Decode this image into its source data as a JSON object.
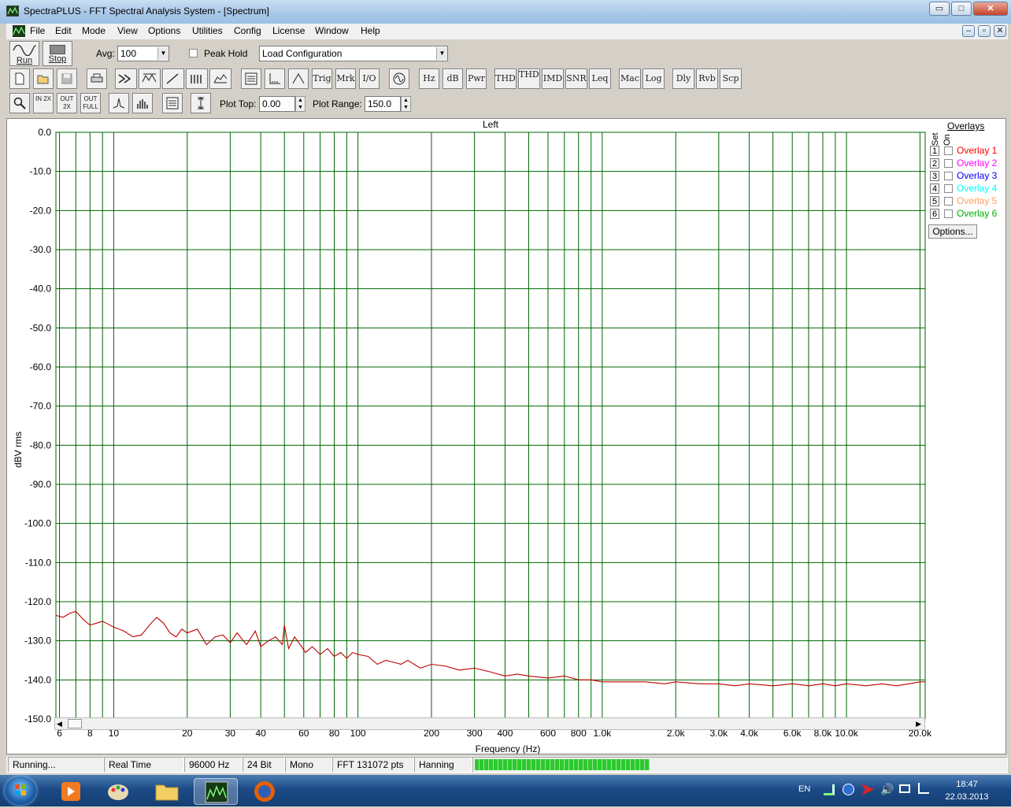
{
  "window": {
    "title": "SpectraPLUS - FFT Spectral Analysis System - [Spectrum]",
    "controls": [
      "▭",
      "□",
      "✕"
    ]
  },
  "mdi_controls": [
    "–",
    "▫",
    "✕"
  ],
  "menu": [
    "File",
    "Edit",
    "Mode",
    "View",
    "Options",
    "Utilities",
    "Config",
    "License",
    "Window",
    "Help"
  ],
  "toolbar1": {
    "run_label": "Run",
    "stop_label": "Stop",
    "avg_label": "Avg:",
    "avg_value": "100",
    "peak_hold_label": "Peak Hold",
    "config_value": "Load Configuration"
  },
  "toolbar2": {
    "buttons": [
      "Trig",
      "Mrk",
      "I/O",
      "Hz",
      "dB",
      "Pwr",
      "THD",
      "THD+N",
      "IMD",
      "SNR",
      "Leq",
      "Mac",
      "Log",
      "Dly",
      "Rvb",
      "Scp"
    ]
  },
  "toolbar3": {
    "zoom_in": "IN 2X",
    "zoom_out": "OUT 2X",
    "zoom_full": "OUT FULL",
    "plot_top_label": "Plot Top:",
    "plot_top_value": "0.00",
    "plot_range_label": "Plot Range:",
    "plot_range_value": "150.0"
  },
  "overlays": {
    "title": "Overlays",
    "set_label": "Set",
    "on_label": "On",
    "items": [
      {
        "num": "1",
        "name": "Overlay 1",
        "color": "#ff0000"
      },
      {
        "num": "2",
        "name": "Overlay 2",
        "color": "#ff00ff"
      },
      {
        "num": "3",
        "name": "Overlay 3",
        "color": "#0000ff"
      },
      {
        "num": "4",
        "name": "Overlay 4",
        "color": "#00ffff"
      },
      {
        "num": "5",
        "name": "Overlay 5",
        "color": "#ffa060"
      },
      {
        "num": "6",
        "name": "Overlay 6",
        "color": "#00b000"
      }
    ],
    "options_label": "Options..."
  },
  "chart_data": {
    "type": "line",
    "title": "Left",
    "xlabel": "Frequency (Hz)",
    "ylabel": "dBV rms",
    "x_scale": "log",
    "xlim": [
      5.8,
      21000
    ],
    "ylim": [
      -150,
      0
    ],
    "grid": true,
    "grid_color": "#006400",
    "trace_color": "#c00000",
    "y_ticks": [
      "0.0",
      "-10.0",
      "-20.0",
      "-30.0",
      "-40.0",
      "-50.0",
      "-60.0",
      "-70.0",
      "-80.0",
      "-90.0",
      "-100.0",
      "-110.0",
      "-120.0",
      "-130.0",
      "-140.0",
      "-150.0"
    ],
    "x_tick_labels": [
      {
        "v": 6,
        "t": "6"
      },
      {
        "v": 8,
        "t": "8"
      },
      {
        "v": 10,
        "t": "10"
      },
      {
        "v": 20,
        "t": "20"
      },
      {
        "v": 30,
        "t": "30"
      },
      {
        "v": 40,
        "t": "40"
      },
      {
        "v": 60,
        "t": "60"
      },
      {
        "v": 80,
        "t": "80"
      },
      {
        "v": 100,
        "t": "100"
      },
      {
        "v": 200,
        "t": "200"
      },
      {
        "v": 300,
        "t": "300"
      },
      {
        "v": 400,
        "t": "400"
      },
      {
        "v": 600,
        "t": "600"
      },
      {
        "v": 800,
        "t": "800"
      },
      {
        "v": 1000,
        "t": "1.0k"
      },
      {
        "v": 2000,
        "t": "2.0k"
      },
      {
        "v": 3000,
        "t": "3.0k"
      },
      {
        "v": 4000,
        "t": "4.0k"
      },
      {
        "v": 6000,
        "t": "6.0k"
      },
      {
        "v": 8000,
        "t": "8.0k"
      },
      {
        "v": 10000,
        "t": "10.0k"
      },
      {
        "v": 20000,
        "t": "20.0k"
      }
    ],
    "series": [
      {
        "x": [
          5.8,
          6.2,
          6.6,
          7,
          7.5,
          8,
          8.5,
          9,
          10,
          11,
          12,
          13,
          14,
          15,
          16,
          17,
          18,
          19,
          20,
          22,
          24,
          26,
          28,
          30,
          32,
          35,
          38,
          40,
          43,
          46,
          49,
          50,
          52,
          55,
          58,
          61,
          65,
          70,
          75,
          80,
          85,
          90,
          95,
          100,
          110,
          120,
          130,
          140,
          150,
          160,
          180,
          200,
          230,
          260,
          300,
          350,
          400,
          450,
          500,
          600,
          700,
          800,
          900,
          1000,
          1200,
          1500,
          1800,
          2000,
          2500,
          3000,
          3500,
          4000,
          5000,
          6000,
          7000,
          8000,
          9000,
          10000,
          12000,
          14000,
          16000,
          18000,
          20000,
          21000
        ],
        "y": [
          -123.5,
          -124,
          -123,
          -122.5,
          -124.5,
          -126,
          -125.5,
          -125,
          -126.5,
          -127.5,
          -129,
          -128.5,
          -126,
          -124,
          -125.5,
          -128,
          -129,
          -127,
          -128,
          -127,
          -131,
          -129,
          -128.5,
          -130.5,
          -128,
          -131,
          -127.5,
          -131.5,
          -130,
          -129,
          -131,
          -126,
          -132,
          -129,
          -131,
          -133,
          -131.5,
          -133.5,
          -132,
          -134,
          -133,
          -134.5,
          -133,
          -133.5,
          -134,
          -136,
          -135,
          -135.5,
          -136,
          -135,
          -137,
          -136,
          -136.5,
          -137.5,
          -137,
          -138,
          -139,
          -138.5,
          -139,
          -139.5,
          -139,
          -140,
          -140,
          -140.5,
          -140.5,
          -140.5,
          -141,
          -140.5,
          -141,
          -141,
          -141.5,
          -141,
          -141.5,
          -141,
          -141.5,
          -141,
          -141.5,
          -141,
          -141.5,
          -141,
          -141.5,
          -141,
          -140.5,
          -140.5
        ]
      }
    ]
  },
  "status": {
    "state": "Running...",
    "mode": "Real Time",
    "rate": "96000 Hz",
    "bits": "24 Bit",
    "channels": "Mono",
    "fft": "FFT 131072 pts",
    "window": "Hanning",
    "progress": 1.0,
    "progress_color": "#2dc92d"
  },
  "taskbar": {
    "lang": "EN",
    "time": "18:47",
    "date": "22.03.2013"
  }
}
